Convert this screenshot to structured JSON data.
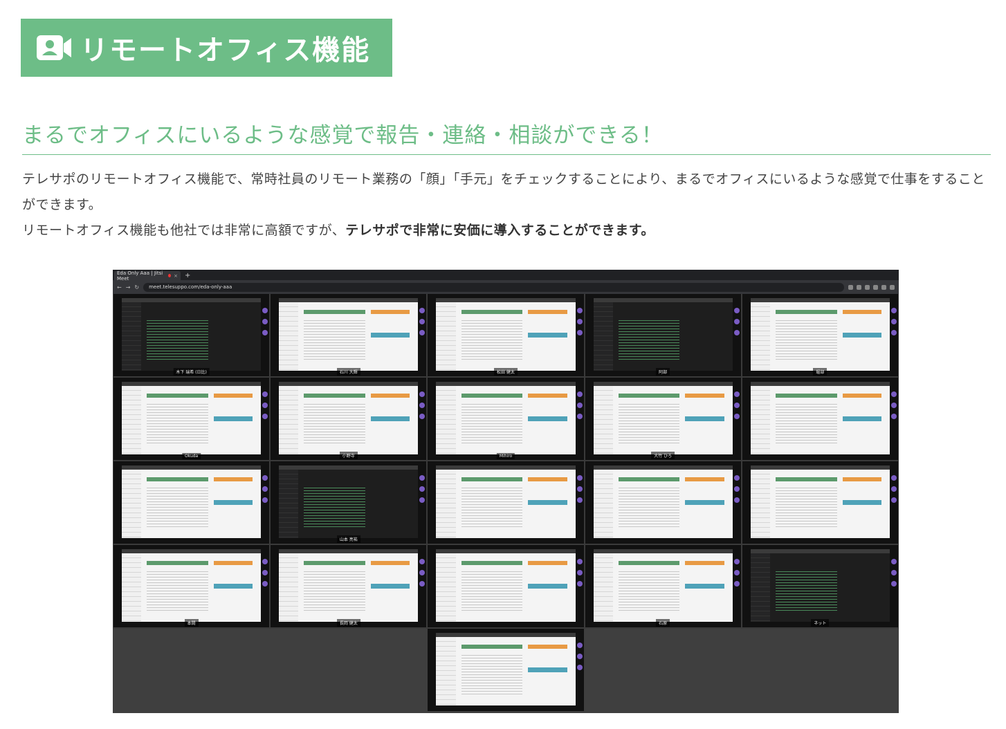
{
  "section": {
    "title": "リモートオフィス機能",
    "icon": "video-user-icon",
    "accent": "#6dbd87"
  },
  "subheading": "まるでオフィスにいるような感覚で報告・連絡・相談ができる！",
  "body": {
    "line1": "テレサポのリモートオフィス機能で、常時社員のリモート業務の「顔」「手元」をチェックすることにより、まるでオフィスにいるような感覚で仕事をすることができます。",
    "line2_normal": "リモートオフィス機能も他社では非常に高額ですが、",
    "line2_bold": "テレサポで非常に安価に導入することができます。"
  },
  "screenshot": {
    "tab_title": "Eda Only Aaa | Jitsi Meet",
    "url": "meet.telesuppo.com/eda-only-aaa",
    "tiles": [
      {
        "label": "木下 瑞希 (日比)",
        "style": "dark"
      },
      {
        "label": "石川 大輝",
        "style": "light"
      },
      {
        "label": "松田 健太",
        "style": "light"
      },
      {
        "label": "阿部",
        "style": "dark"
      },
      {
        "label": "堀部",
        "style": "light"
      },
      {
        "label": "Okuda",
        "style": "light"
      },
      {
        "label": "小野寺",
        "style": "light"
      },
      {
        "label": "Mihiro",
        "style": "light"
      },
      {
        "label": "大竹 ひろ",
        "style": "light"
      },
      {
        "label": "",
        "style": "light"
      },
      {
        "label": "",
        "style": "light"
      },
      {
        "label": "山本 亮祐",
        "style": "dark"
      },
      {
        "label": "",
        "style": "light"
      },
      {
        "label": "",
        "style": "light"
      },
      {
        "label": "",
        "style": "light"
      },
      {
        "label": "本間",
        "style": "light"
      },
      {
        "label": "長岡 健太",
        "style": "light"
      },
      {
        "label": "",
        "style": "light"
      },
      {
        "label": "石原",
        "style": "light"
      },
      {
        "label": "ネット",
        "style": "dark"
      },
      {
        "label": "",
        "style": "light"
      }
    ]
  }
}
